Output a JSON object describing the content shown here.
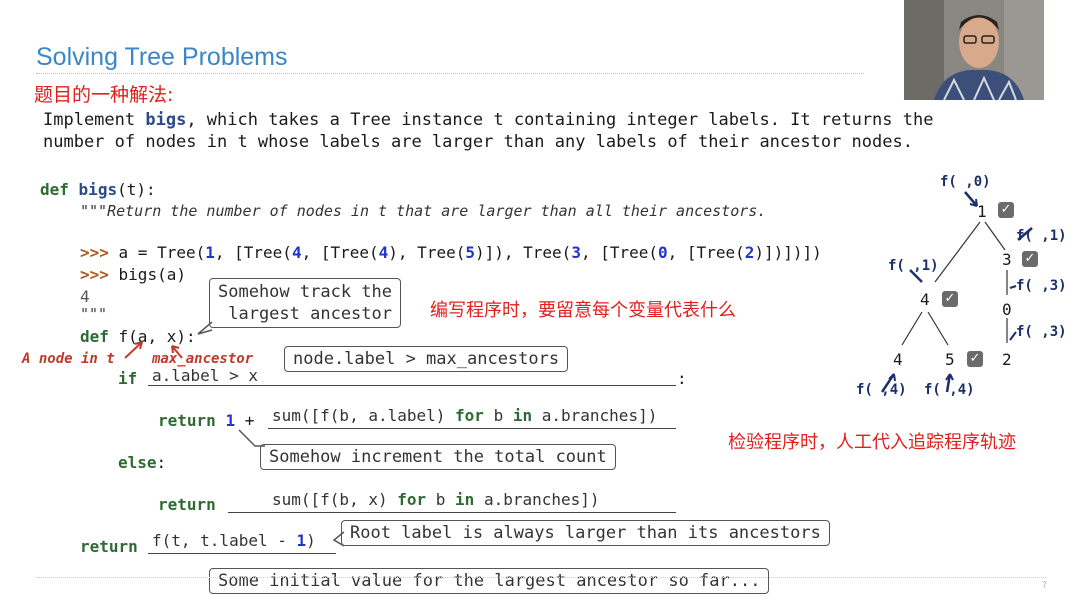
{
  "slide": {
    "title": "Solving Tree Problems",
    "subtitle_cn": "题目的一种解法:",
    "prompt_line1_pre": "Implement ",
    "prompt_line1_bold": "bigs",
    "prompt_line1_post": ", which takes a Tree instance t containing integer labels. It returns the",
    "prompt_line2": "number of nodes in t whose labels are larger than any labels of their ancestor nodes.",
    "page_number": "7"
  },
  "code": {
    "def_kw": "def",
    "def_name": "bigs",
    "def_sig": "(t):",
    "docstring_open": "\"\"\"",
    "docstring": "Return the number of nodes in t that are larger than all their ancestors.",
    "doctest1_prompt": ">>>",
    "doctest1_a": " a = Tree(",
    "doctest1_n1": "1",
    "doctest1_b": ", [Tree(",
    "doctest1_n4": "4",
    "doctest1_c": ", [Tree(",
    "doctest1_n4b": "4",
    "doctest1_d": "), Tree(",
    "doctest1_n5": "5",
    "doctest1_e": ")]), Tree(",
    "doctest1_n3": "3",
    "doctest1_f": ", [Tree(",
    "doctest1_n0": "0",
    "doctest1_g": ", [Tree(",
    "doctest1_n2": "2",
    "doctest1_h": ")])])])",
    "doctest2_prompt": ">>>",
    "doctest2": " bigs(a)",
    "doctest_result": "4",
    "docstring_close": "\"\"\"",
    "inner_def": "def",
    "inner_sig": " f(a, x):",
    "if_kw": "if",
    "if_cond": "a.label > x",
    "colon": ":",
    "return1_kw": "return",
    "return1_num": "1",
    "return1_plus": " +",
    "return1_sum": "sum([f(b, a.label) ",
    "return1_for": "for",
    "return1_b": " b ",
    "return1_in": "in",
    "return1_tail": " a.branches])",
    "else_kw": "else",
    "else_colon": ":",
    "return2_kw": "return",
    "return2_sum": "sum([f(b, x) ",
    "return2_for": "for",
    "return2_b": " b ",
    "return2_in": "in",
    "return2_tail": " a.branches])",
    "return3_kw": "return",
    "return3_call_pre": "f(t, t.label - ",
    "return3_num": "1",
    "return3_call_post": ")"
  },
  "callouts": {
    "track_largest": "Somehow track the\n largest ancestor",
    "node_label": "node.label > max_ancestors",
    "increment": "Somehow increment the total count",
    "root_label": "Root label is always larger than its ancestors",
    "initial_value": "Some initial value for the largest ancestor so far..."
  },
  "annotations": {
    "a_node_in_t": "A node in t",
    "max_ancestor": "max_ancestor",
    "cn_note1": "编写程序时，要留意每个变量代表什么",
    "cn_note2": "检验程序时，人工代入追踪程序轨迹"
  },
  "tree_diagram": {
    "root": "1",
    "n4": "4",
    "n3": "3",
    "n4_leaf": "4",
    "n5": "5",
    "n0": "0",
    "n2": "2",
    "call_root": "f( ,0)",
    "call_3": "f( ,1)",
    "call_4": "f( ,1)",
    "call_0": "f( ,3)",
    "call_2": "f( ,3)",
    "call_4leaf": "f( ,4)",
    "call_5": "f( ,4)",
    "check_symbol": "✓"
  },
  "colors": {
    "title": "#3a86c8",
    "chinese_note": "#e0201c",
    "keyword": "#2e6b33",
    "number": "#2233cc",
    "doctest_prompt": "#b05a1e"
  }
}
